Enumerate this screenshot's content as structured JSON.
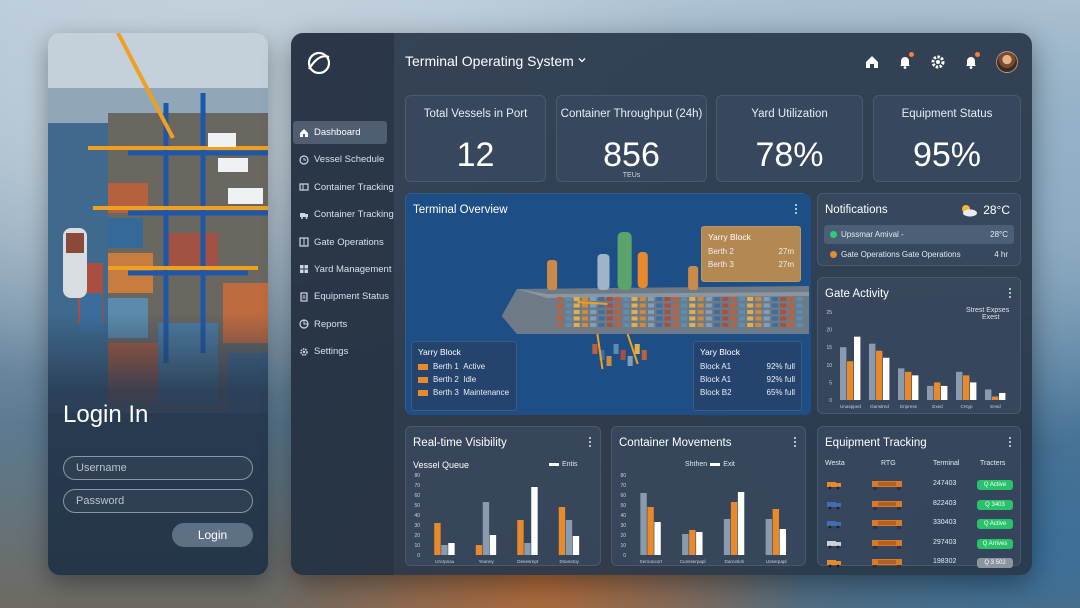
{
  "login": {
    "title": "Login In",
    "username_placeholder": "Username",
    "password_placeholder": "Password",
    "button_label": "Login"
  },
  "header": {
    "title": "Terminal Operating System"
  },
  "sidebar": {
    "items": [
      {
        "label": "Dashboard",
        "icon": "home-icon",
        "active": true
      },
      {
        "label": "Vessel Schedule",
        "icon": "clock-icon",
        "active": false
      },
      {
        "label": "Container Tracking",
        "icon": "container-icon",
        "active": false
      },
      {
        "label": "Container Tracking",
        "icon": "truck-icon",
        "active": false
      },
      {
        "label": "Gate Operations",
        "icon": "gate-icon",
        "active": false
      },
      {
        "label": "Yard Management",
        "icon": "yard-icon",
        "active": false
      },
      {
        "label": "Equipment Status",
        "icon": "clipboard-icon",
        "active": false
      },
      {
        "label": "Reports",
        "icon": "chart-icon",
        "active": false
      },
      {
        "label": "Settings",
        "icon": "gear-icon",
        "active": false
      }
    ]
  },
  "kpis": [
    {
      "label": "Total Vessels in Port",
      "value": "12",
      "unit": ""
    },
    {
      "label": "Container Throughput (24h)",
      "value": "856",
      "unit": "TEUs"
    },
    {
      "label": "Yard Utilization",
      "value": "78%",
      "unit": ""
    },
    {
      "label": "Equipment Status",
      "value": "95%",
      "unit": ""
    }
  ],
  "overview": {
    "title": "Terminal Overview",
    "callout_top": {
      "title": "Yarry Block",
      "rows": [
        {
          "label": "Berth 2",
          "value": "27m"
        },
        {
          "label": "Berth 3",
          "value": "27m"
        }
      ]
    },
    "callout_left": {
      "title": "Yarry Block",
      "rows": [
        {
          "label": "Berth 1",
          "value": "Active"
        },
        {
          "label": "Berth 2",
          "value": "Idle"
        },
        {
          "label": "Berth 3",
          "value": "Maintenance"
        }
      ]
    },
    "callout_right": {
      "title": "Yary Block",
      "rows": [
        {
          "label": "Block A1",
          "value": "92% full"
        },
        {
          "label": "Block A1",
          "value": "92% full"
        },
        {
          "label": "Block B2",
          "value": "65% full"
        }
      ]
    }
  },
  "notifications": {
    "title": "Notifications",
    "weather_temp": "28°C",
    "items": [
      {
        "text": "Upssmar Amival -",
        "value": "28°C",
        "color": "#2ecc71"
      },
      {
        "text": "Gate Operations Gate Operations",
        "value": "4 hr",
        "color": "#e8892c"
      }
    ]
  },
  "gate_activity": {
    "title": "Gate Activity",
    "legend": [
      "Strest",
      "Expses",
      "Exest"
    ],
    "chart_data": {
      "type": "bar",
      "categories": [
        "Unaspped",
        "Oanstred",
        "Enpress",
        "Exed",
        "Crsyp",
        "Eesd"
      ],
      "ylim": [
        0,
        25
      ],
      "y_ticks": [
        "25",
        "20",
        "15",
        "10",
        "5",
        "0"
      ],
      "series": [
        {
          "name": "Strest",
          "color": "#8a9bb0",
          "values": [
            15,
            16,
            9,
            4,
            8,
            3
          ]
        },
        {
          "name": "Expses",
          "color": "#e8892c",
          "values": [
            11,
            14,
            8,
            5,
            7,
            1
          ]
        },
        {
          "name": "Exest",
          "color": "#ffffff",
          "values": [
            18,
            12,
            7,
            4,
            5,
            2
          ]
        }
      ]
    }
  },
  "realtime": {
    "title": "Real-time Visibility",
    "subtitle": "Vessel Queue",
    "legend": "Entis",
    "chart_data": {
      "type": "bar",
      "categories": [
        "Urorpnau",
        "Yeaney",
        "Desesrept",
        "Dsanetoy"
      ],
      "ylim": [
        0,
        80
      ],
      "y_ticks": [
        "80",
        "70",
        "60",
        "50",
        "40",
        "30",
        "20",
        "10",
        "0"
      ],
      "series": [
        {
          "name": "",
          "color": "#e8892c",
          "values": [
            32,
            10,
            35,
            48
          ]
        },
        {
          "name": "",
          "color": "#8a9bb0",
          "values": [
            10,
            53,
            12,
            35
          ]
        },
        {
          "name": "",
          "color": "#ffffff",
          "values": [
            12,
            20,
            68,
            19
          ]
        }
      ]
    }
  },
  "container_moves": {
    "title": "Container Movements",
    "legend": [
      "Shthen",
      "Exit"
    ],
    "chart_data": {
      "type": "bar",
      "categories": [
        "Serooncort",
        "Cunsserpapl",
        "Darcetioh",
        "Uoserpapl"
      ],
      "ylim": [
        0,
        80
      ],
      "y_ticks": [
        "80",
        "70",
        "60",
        "50",
        "40",
        "30",
        "20",
        "10",
        "0"
      ],
      "series": [
        {
          "name": "",
          "color": "#8a9bb0",
          "values": [
            62,
            21,
            36,
            36
          ]
        },
        {
          "name": "",
          "color": "#e8892c",
          "values": [
            48,
            25,
            53,
            46
          ]
        },
        {
          "name": "",
          "color": "#ffffff",
          "values": [
            33,
            23,
            63,
            26
          ]
        }
      ]
    }
  },
  "equipment": {
    "title": "Equipment Tracking",
    "headers": [
      "Westa",
      "RTG",
      "Terminal",
      "Tracters"
    ],
    "rows": [
      {
        "value": "247403",
        "status": "Q Active",
        "status_color": "#27c26a"
      },
      {
        "value": "822403",
        "status": "Q 3403",
        "status_color": "#27c26a"
      },
      {
        "value": "330403",
        "status": "Q Active",
        "status_color": "#27c26a"
      },
      {
        "value": "297403",
        "status": "Q Arrives",
        "status_color": "#27c26a"
      },
      {
        "value": "198302",
        "status": "Q 3 502",
        "status_color": "#8b95a0"
      }
    ]
  }
}
